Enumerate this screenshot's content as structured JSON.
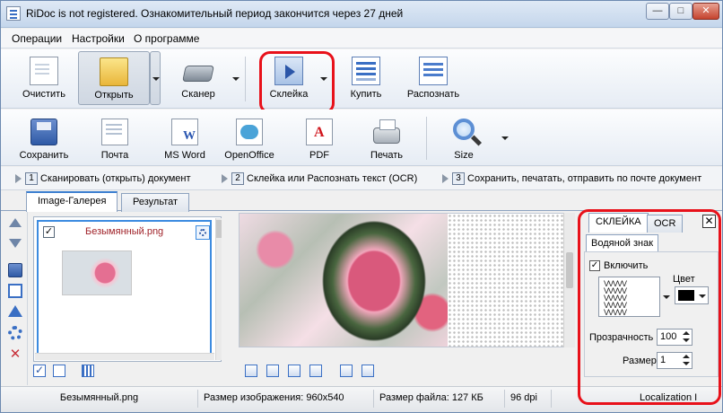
{
  "window": {
    "title": "RiDoc is not registered. Ознакомительный период закончится через 27 дней",
    "minimize": "—",
    "maximize": "□",
    "close": "✕"
  },
  "menu": [
    "Операции",
    "Настройки",
    "О программе"
  ],
  "toolbar1": [
    {
      "label": "Очистить",
      "icon": "document-icon"
    },
    {
      "label": "Открыть",
      "icon": "folder-open-icon"
    },
    {
      "label": "Сканер",
      "icon": "scanner-icon"
    },
    {
      "label": "Склейка",
      "icon": "glue-icon"
    },
    {
      "label": "Купить",
      "icon": "buy-icon"
    },
    {
      "label": "Распознать",
      "icon": "recognize-icon"
    }
  ],
  "toolbar2": [
    {
      "label": "Сохранить",
      "icon": "save-icon"
    },
    {
      "label": "Почта",
      "icon": "mail-icon"
    },
    {
      "label": "MS Word",
      "icon": "word-icon"
    },
    {
      "label": "OpenOffice",
      "icon": "openoffice-icon"
    },
    {
      "label": "PDF",
      "icon": "pdf-icon"
    },
    {
      "label": "Печать",
      "icon": "printer-icon"
    },
    {
      "label": "Size",
      "icon": "magnifier-icon"
    }
  ],
  "steps": [
    {
      "num": "1",
      "text": "Сканировать (открыть) документ"
    },
    {
      "num": "2",
      "text": "Склейка или Распознать текст (OCR)"
    },
    {
      "num": "3",
      "text": "Сохранить, печатать, отправить по почте документ"
    }
  ],
  "tabs": [
    "Image-Галерея",
    "Результат"
  ],
  "gallery": {
    "item_name": "Безымянный.png",
    "checked": "✓"
  },
  "panel": {
    "tabs": [
      "СКЛЕЙКА",
      "OCR"
    ],
    "close": "✕",
    "subtab": "Водяной знак",
    "enable_label": "Включить",
    "enable_checked": "✓",
    "color_label": "Цвет",
    "pattern_rows": [
      "VVVVV",
      "VVVVV",
      "VVVVV",
      "VVVVV",
      "VVVVV"
    ],
    "transparency_label": "Прозрачность",
    "transparency_value": "100",
    "size_label": "Размер",
    "size_value": "1",
    "color_value": "#000000"
  },
  "status": {
    "file": "Безымянный.png",
    "image_size": "Размер изображения: 960x540",
    "file_size": "Размер файла: 127 КБ",
    "dpi": "96 dpi",
    "localization": "Localization I"
  },
  "colors": {
    "highlight": "#e8111a",
    "accent": "#3c7fd0"
  }
}
